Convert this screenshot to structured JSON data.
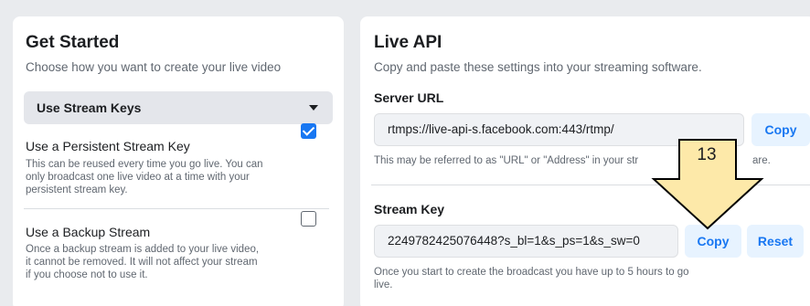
{
  "get_started": {
    "title": "Get Started",
    "subtitle": "Choose how you want to create your live video",
    "dropdown_label": "Use Stream Keys",
    "persistent": {
      "title": "Use a Persistent Stream Key",
      "desc_line1": "This can be reused every time you go live. You can",
      "desc_line2": "only broadcast one live video at a time with your",
      "desc_line3": "persistent stream key.",
      "checked": true
    },
    "backup": {
      "title": "Use a Backup Stream",
      "desc_line1": "Once a backup stream is added to your live video,",
      "desc_line2": "it cannot be removed. It will not affect your stream",
      "desc_line3": "if you choose not to use it.",
      "checked": false
    }
  },
  "live_api": {
    "title": "Live API",
    "subtitle": "Copy and paste these settings into your streaming software.",
    "server_url": {
      "label": "Server URL",
      "value": "rtmps://live-api-s.facebook.com:443/rtmp/",
      "copy_label": "Copy",
      "note_start": "This may be referred to as \"URL\" or \"Address\" in your str",
      "note_end": "are."
    },
    "stream_key": {
      "label": "Stream Key",
      "value": "2249782425076448?s_bl=1&s_ps=1&s_sw=0",
      "copy_label": "Copy",
      "reset_label": "Reset",
      "note_line1": "Once you start to create the broadcast you have up to 5 hours to go",
      "note_line2": "live."
    }
  },
  "callout": {
    "number": "13",
    "fill_color": "#fde9a9",
    "stroke_color": "#000000"
  },
  "colors": {
    "accent": "#1877f2",
    "button_bg": "#e7f3ff"
  }
}
